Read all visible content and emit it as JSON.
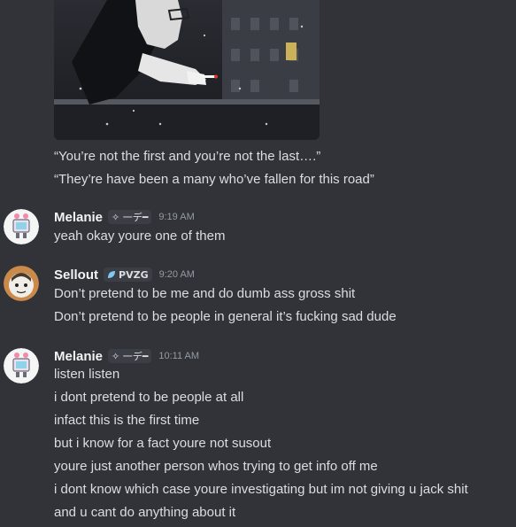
{
  "embed": {
    "quote1": "“You’re not the first and you’re not the last….”",
    "quote2": "“They’re have been a many who’ve fallen for this road”"
  },
  "messages": [
    {
      "username": "Melanie",
      "tag": "✧ 一デ━",
      "time": "9:19 AM",
      "lines": [
        "yeah okay youre one of them"
      ]
    },
    {
      "username": "Sellout",
      "tag": "PVZG",
      "time": "9:20 AM",
      "lines": [
        "Don’t pretend to be me and do dumb ass gross shit",
        "Don’t pretend to be people in general it’s fucking sad dude"
      ]
    },
    {
      "username": "Melanie",
      "tag": "✧ 一デ━",
      "time": "10:11 AM",
      "lines": [
        "listen listen",
        "i dont pretend to be people at all",
        "infact this is the first time",
        "but i know for a fact youre not susout",
        "youre just another person whos trying to get info off me",
        "i dont know which case youre investigating but im not giving u jack shit",
        "and u cant do anything about it"
      ]
    }
  ],
  "colors": {
    "background": "#313338",
    "username": "#f2f3f5",
    "timestamp": "#949ba4",
    "text": "#dbdee1",
    "pvzg_icon": "#7ec8f5"
  }
}
